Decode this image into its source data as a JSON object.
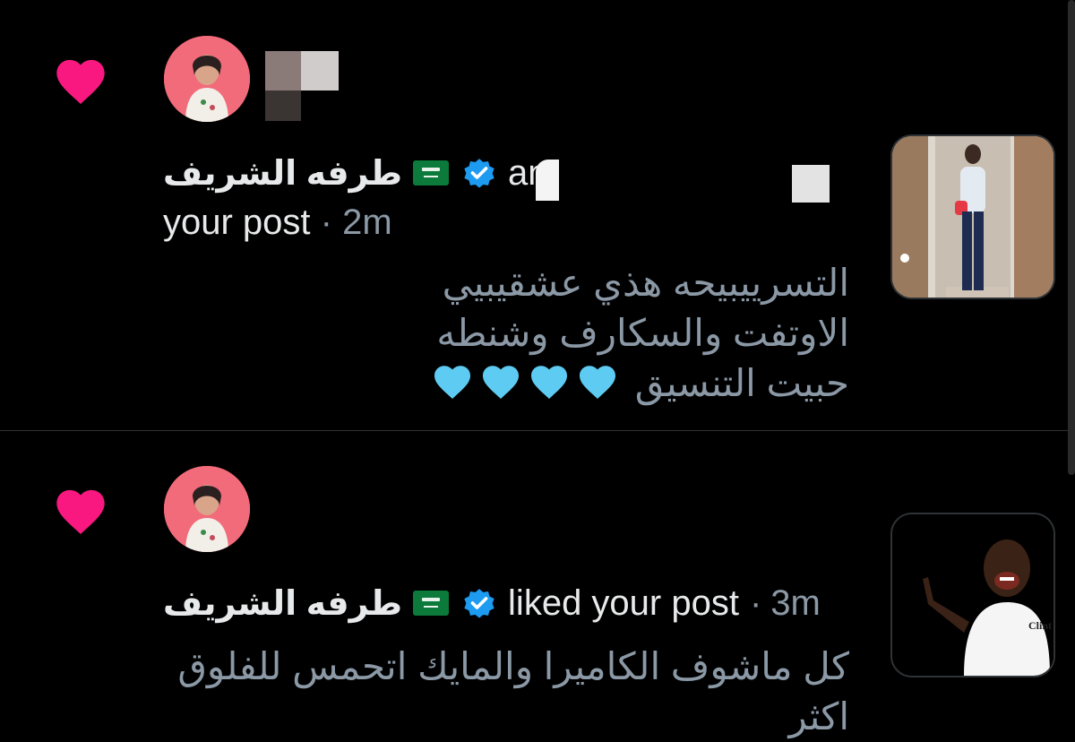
{
  "notifications": [
    {
      "icon": "heart-icon",
      "author_name": "طرفه الشريف",
      "flag": "saudi-arabia-flag",
      "verified": true,
      "action_visible": "an",
      "action_line2": "your post",
      "separator": "·",
      "time": "2m",
      "text_lines": [
        "التسرييبيحه هذي عشقيبيي",
        "الاوتفت والسكارف وشنطه",
        "حبيت التنسيق"
      ],
      "emoji": "💙💙💙💙"
    },
    {
      "icon": "heart-icon",
      "author_name": "طرفه الشريف",
      "flag": "saudi-arabia-flag",
      "verified": true,
      "action": "liked your post",
      "separator": "·",
      "time": "3m",
      "text_lines": [
        "كل ماشوف الكاميرا والمايك اتحمس للفلوق",
        "اكثر"
      ]
    }
  ],
  "colors": {
    "background": "#000000",
    "heart": "#f91880",
    "verified": "#1d9bf0",
    "muted_text": "#8b98a5",
    "primary_text": "#e7e9ea",
    "blue_heart": "#5ecbf2"
  }
}
